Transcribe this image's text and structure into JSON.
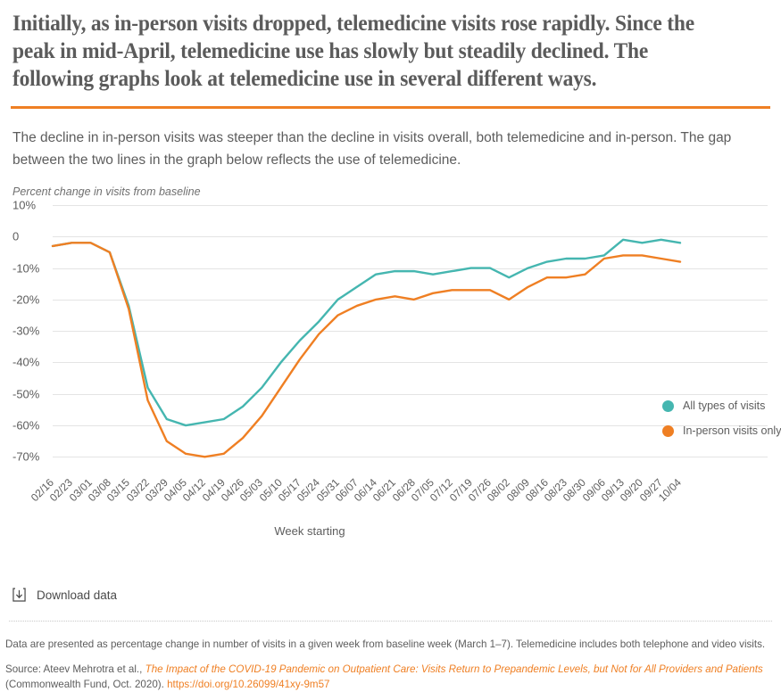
{
  "headline": "Initially, as in-person visits dropped, telemedicine visits rose rapidly. Since the peak in mid-April, telemedicine use has slowly but steadily declined. The following graphs look at telemedicine use in several different ways.",
  "subtitle": "The decline in in-person visits was steeper than the decline in visits overall, both telemedicine and in-person. The gap between the two lines in the graph below reflects the use of telemedicine.",
  "download": {
    "label": "Download data",
    "icon": "download-icon"
  },
  "footnotes": {
    "note": "Data are presented as percentage change in number of visits in a given week from baseline week (March 1–7). Telemedicine includes both telephone and video visits.",
    "source_prefix": "Source: Ateev Mehrotra et al., ",
    "source_title": "The Impact of the COVID-19 Pandemic on Outpatient Care: Visits Return to Prepandemic Levels, but Not for All Providers and Patients",
    "source_pub": " (Commonwealth Fund, Oct. 2020). ",
    "source_url": "https://doi.org/10.26099/41xy-9m57"
  },
  "colors": {
    "accent_rule": "#ef7f23",
    "teal": "#45b6b0",
    "orange": "#ef7f23",
    "gridline": "#e4e4e4",
    "text": "#5d5d5d"
  },
  "chart_data": {
    "type": "line",
    "title": "",
    "ylabel": "Percent change in visits from baseline",
    "xlabel": "Week starting",
    "ylim": [
      -75,
      10
    ],
    "yticks": [
      10,
      0,
      -10,
      -20,
      -30,
      -40,
      -50,
      -60,
      -70
    ],
    "ytick_labels": [
      "10%",
      "0",
      "-10%",
      "-20%",
      "-30%",
      "-40%",
      "-50%",
      "-60%",
      "-70%"
    ],
    "grid": true,
    "legend_position": "right",
    "categories": [
      "02/16",
      "02/23",
      "03/01",
      "03/08",
      "03/15",
      "03/22",
      "03/29",
      "04/05",
      "04/12",
      "04/19",
      "04/26",
      "05/03",
      "05/10",
      "05/17",
      "05/24",
      "05/31",
      "06/07",
      "06/14",
      "06/21",
      "06/28",
      "07/05",
      "07/12",
      "07/19",
      "07/26",
      "08/02",
      "08/09",
      "08/16",
      "08/23",
      "08/30",
      "09/06",
      "09/13",
      "09/20",
      "09/27",
      "10/04"
    ],
    "series": [
      {
        "name": "All types of visits",
        "color": "#45b6b0",
        "values": [
          -3,
          -2,
          -2,
          -5,
          -22,
          -48,
          -58,
          -60,
          -59,
          -58,
          -54,
          -48,
          -40,
          -33,
          -27,
          -20,
          -16,
          -12,
          -11,
          -11,
          -12,
          -11,
          -10,
          -10,
          -13,
          -10,
          -8,
          -7,
          -7,
          -6,
          -1,
          -2,
          -1,
          -2
        ]
      },
      {
        "name": "In-person visits only",
        "color": "#ef7f23",
        "values": [
          -3,
          -2,
          -2,
          -5,
          -23,
          -52,
          -65,
          -69,
          -70,
          -69,
          -64,
          -57,
          -48,
          -39,
          -31,
          -25,
          -22,
          -20,
          -19,
          -20,
          -18,
          -17,
          -17,
          -17,
          -20,
          -16,
          -13,
          -13,
          -12,
          -7,
          -6,
          -6,
          -7,
          -8
        ]
      }
    ]
  }
}
